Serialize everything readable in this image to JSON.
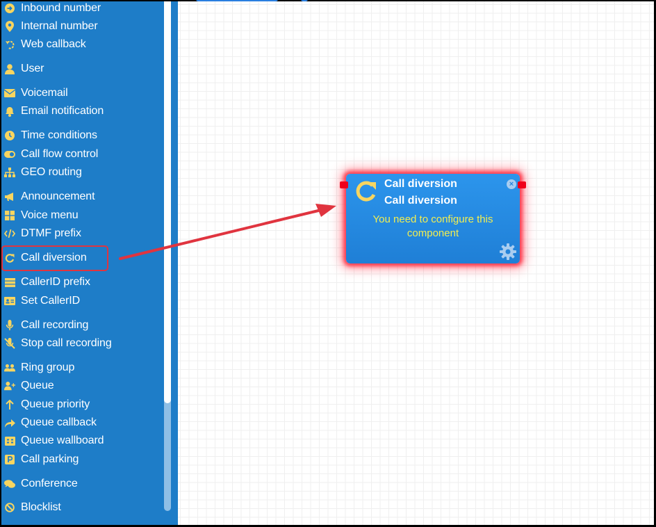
{
  "sidebar": {
    "items": [
      {
        "label": "Inbound number",
        "icon": "arrow-circle-right-icon"
      },
      {
        "label": "Internal number",
        "icon": "map-pin-icon"
      },
      {
        "label": "Web callback",
        "icon": "callback-icon"
      },
      {
        "label": "User",
        "icon": "user-icon"
      },
      {
        "label": "Voicemail",
        "icon": "envelope-icon"
      },
      {
        "label": "Email notification",
        "icon": "bell-icon"
      },
      {
        "label": "Time conditions",
        "icon": "clock-icon"
      },
      {
        "label": "Call flow control",
        "icon": "toggle-icon"
      },
      {
        "label": "GEO routing",
        "icon": "sitemap-icon"
      },
      {
        "label": "Announcement",
        "icon": "megaphone-icon"
      },
      {
        "label": "Voice menu",
        "icon": "grid-icon"
      },
      {
        "label": "DTMF prefix",
        "icon": "code-icon"
      },
      {
        "label": "Call diversion",
        "icon": "redo-icon"
      },
      {
        "label": "CallerID prefix",
        "icon": "list-icon"
      },
      {
        "label": "Set CallerID",
        "icon": "id-card-icon"
      },
      {
        "label": "Call recording",
        "icon": "microphone-icon"
      },
      {
        "label": "Stop call recording",
        "icon": "microphone-slash-icon"
      },
      {
        "label": "Ring group",
        "icon": "users-icon"
      },
      {
        "label": "Queue",
        "icon": "user-plus-icon"
      },
      {
        "label": "Queue priority",
        "icon": "arrow-up-icon"
      },
      {
        "label": "Queue callback",
        "icon": "share-icon"
      },
      {
        "label": "Queue wallboard",
        "icon": "wallboard-icon"
      },
      {
        "label": "Call parking",
        "icon": "parking-icon"
      },
      {
        "label": "Conference",
        "icon": "comments-icon"
      },
      {
        "label": "Blocklist",
        "icon": "ban-icon"
      }
    ],
    "highlighted": "Call diversion"
  },
  "node": {
    "title": "Call diversion",
    "subtitle": "Call diversion",
    "warning": "You need to configure this component",
    "icon": "redo-icon"
  },
  "colors": {
    "sidebar_bg": "#1e7dc8",
    "icon_yellow": "#f7d560",
    "node_bg": "#2a8fe8",
    "warning_text": "#f2ee50",
    "annotation_red": "#e0343f"
  }
}
